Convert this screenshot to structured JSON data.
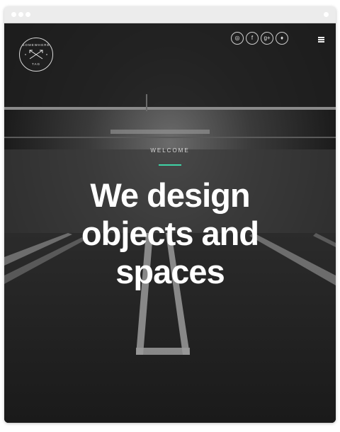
{
  "browser": {
    "dots": [
      "window-dot",
      "window-dot",
      "window-dot"
    ]
  },
  "logo": {
    "top_text": "SOMEWHERE",
    "bottom_text": "TAG"
  },
  "social": [
    {
      "name": "dribbble-icon",
      "glyph": "◎"
    },
    {
      "name": "facebook-icon",
      "glyph": "f"
    },
    {
      "name": "google-plus-icon",
      "glyph": "g+"
    },
    {
      "name": "twitter-icon",
      "glyph": "♦"
    }
  ],
  "menu": {
    "icon": "hamburger-menu-icon"
  },
  "hero": {
    "eyebrow": "WELCOME",
    "line1": "We design",
    "line2": "objects and",
    "line3": "spaces"
  },
  "colors": {
    "accent": "#3fd4a6",
    "background": "#1c1c1c",
    "text": "#ffffff"
  }
}
